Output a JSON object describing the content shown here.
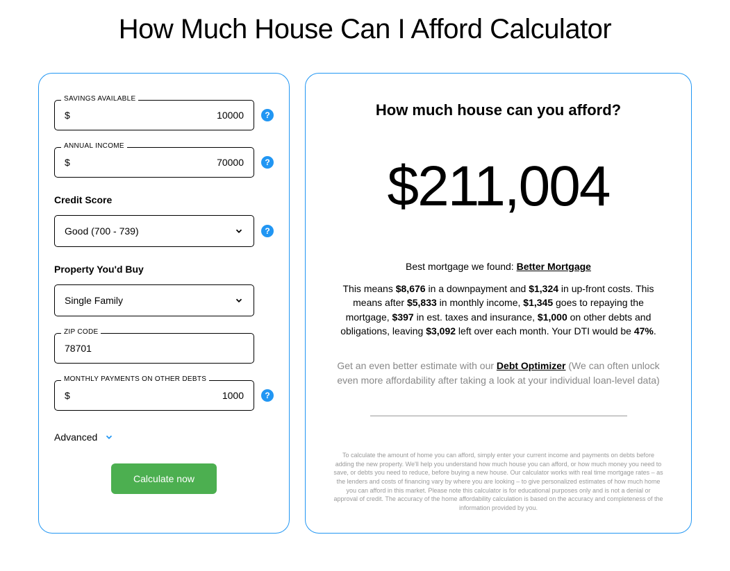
{
  "title": "How Much House Can I Afford Calculator",
  "form": {
    "savings": {
      "label": "SAVINGS AVAILABLE",
      "prefix": "$",
      "value": "10000"
    },
    "income": {
      "label": "ANNUAL INCOME",
      "prefix": "$",
      "value": "70000"
    },
    "credit": {
      "label": "Credit Score",
      "value": "Good (700 - 739)"
    },
    "property": {
      "label": "Property You'd Buy",
      "value": "Single Family"
    },
    "zip": {
      "label": "ZIP CODE",
      "value": "78701"
    },
    "debts": {
      "label": "MONTHLY PAYMENTS ON OTHER DEBTS",
      "prefix": "$",
      "value": "1000"
    },
    "advanced_label": "Advanced",
    "calculate_label": "Calculate now",
    "help_glyph": "?"
  },
  "result": {
    "heading": "How much house can you afford?",
    "amount": "$211,004",
    "mortgage_intro": "Best mortgage we found: ",
    "mortgage_link": "Better Mortgage",
    "detail": {
      "t1": "This means ",
      "downpayment": "$8,676",
      "t2": " in a downpayment and ",
      "upfront": "$1,324",
      "t3": " in up-front costs. This means after ",
      "monthly_income": "$5,833",
      "t4": " in monthly income, ",
      "repaying": "$1,345",
      "t5": " goes to repaying the mortgage, ",
      "taxes": "$397",
      "t6": " in est. taxes and insurance, ",
      "other_debts": "$1,000",
      "t7": " on other debts and obligations, leaving ",
      "leftover": "$3,092",
      "t8": " left over each month. Your DTI would be ",
      "dti": "47%",
      "t9": "."
    },
    "optimizer": {
      "t1": "Get an even better estimate with our ",
      "link": "Debt Optimizer",
      "t2": " (We can often unlock even more affordability after taking a look at your individual loan-level data)"
    },
    "disclaimer": "To calculate the amount of home you can afford, simply enter your current income and payments on debts before adding the new property. We'll help you understand how much house you can afford, or how much money you need to save, or debts you need to reduce, before buying a new house. Our calculator works with real time mortgage rates – as the lenders and costs of financing vary by where you are looking – to give personalized estimates of how much home you can afford in this market. Please note this calculator is for educational purposes only and is not a denial or approval of credit. The accuracy of the home affordability calculation is based on the accuracy and completeness of the information provided by you."
  }
}
